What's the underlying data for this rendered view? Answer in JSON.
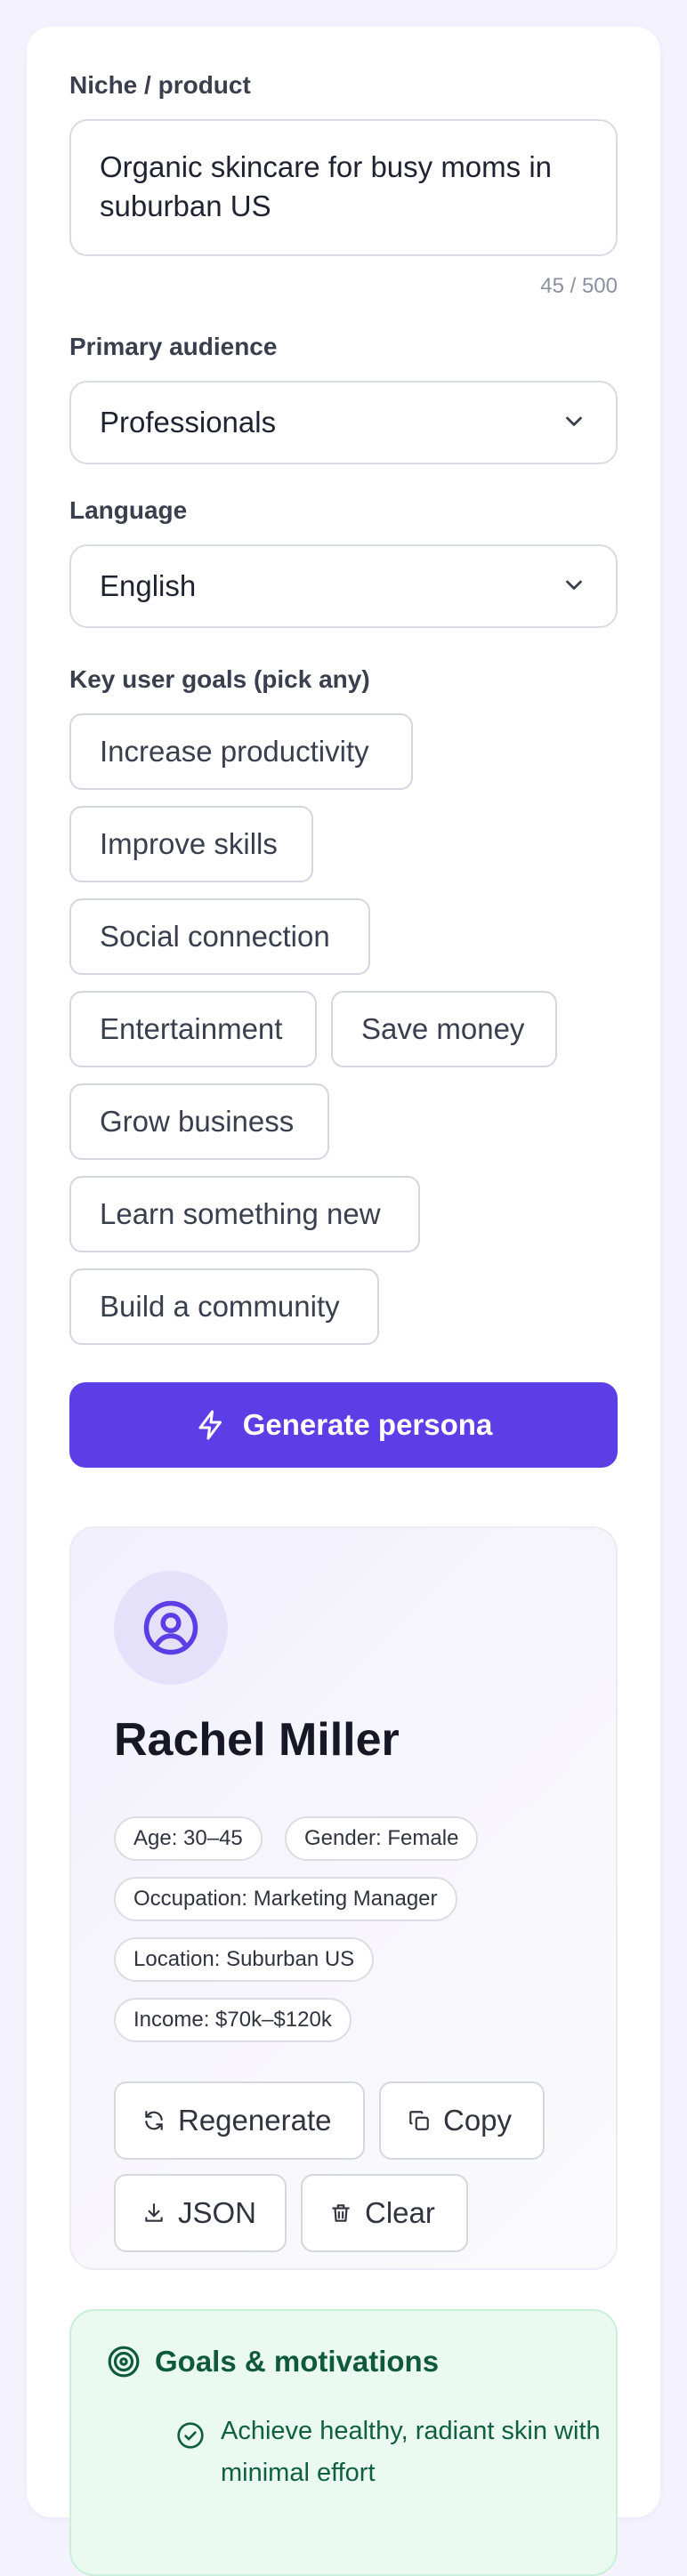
{
  "form": {
    "niche_label": "Niche / product",
    "niche_value": "Organic skincare for busy moms in suburban US",
    "niche_counter": "45 / 500",
    "audience_label": "Primary audience",
    "audience_value": "Professionals",
    "language_label": "Language",
    "language_value": "English",
    "goals_label": "Key user goals (pick any)",
    "goal_chips": [
      "Increase productivity",
      "Improve skills",
      "Social connection",
      "Entertainment",
      "Save money",
      "Grow business",
      "Learn something new",
      "Build a community"
    ],
    "generate_label": "Generate persona"
  },
  "persona": {
    "name": "Rachel Miller",
    "tags": [
      "Age: 30–45",
      "Gender: Female",
      "Occupation: Marketing Manager",
      "Location: Suburban US",
      "Income: $70k–$120k"
    ],
    "actions": {
      "regenerate": "Regenerate",
      "copy": "Copy",
      "json": "JSON",
      "clear": "Clear"
    }
  },
  "goals_section": {
    "title": "Goals & motivations",
    "items": [
      "Achieve healthy, radiant skin with minimal effort"
    ]
  },
  "icons": {
    "select_chevron": "chevron-down-icon",
    "generate": "lightning-icon",
    "avatar": "user-circle-icon",
    "regenerate": "refresh-icon",
    "copy": "copy-icon",
    "json": "download-icon",
    "clear": "trash-icon",
    "goals": "target-icon",
    "goal_item": "check-circle-icon"
  },
  "colors": {
    "accent": "#5c3ee6",
    "goals_bg": "#eafaf0",
    "goals_text": "#0f5a3a"
  }
}
